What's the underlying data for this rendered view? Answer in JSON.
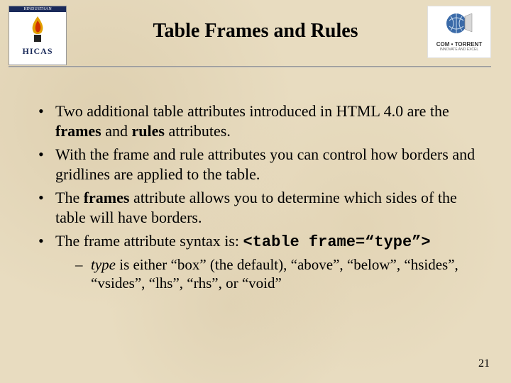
{
  "slide": {
    "title": "Table Frames and Rules",
    "page_number": "21"
  },
  "logos": {
    "left": {
      "top_text": "HINDUSTHAN",
      "bottom_text": "HICAS"
    },
    "right": {
      "brand": "COM • TORRENT",
      "sub": "INNOVATE AND EXCEL"
    }
  },
  "bullets": [
    {
      "pre": "Two additional table attributes introduced in HTML 4.0 are the ",
      "b1": "frames",
      "mid": " and ",
      "b2": "rules",
      "post": " attributes."
    },
    {
      "text": "With the frame and rule attributes you can control how borders and gridlines are applied to the table."
    },
    {
      "pre": "The ",
      "b1": "frames",
      "post": " attribute allows you to determine which sides of the table will have borders."
    },
    {
      "pre": "The frame attribute syntax is: ",
      "code": "<table frame=“type”>"
    }
  ],
  "sub_bullet": {
    "em": "type",
    "rest": " is either “box” (the default), “above”, “below”, “hsides”, “vsides”, “lhs”, “rhs”, or “void”"
  }
}
